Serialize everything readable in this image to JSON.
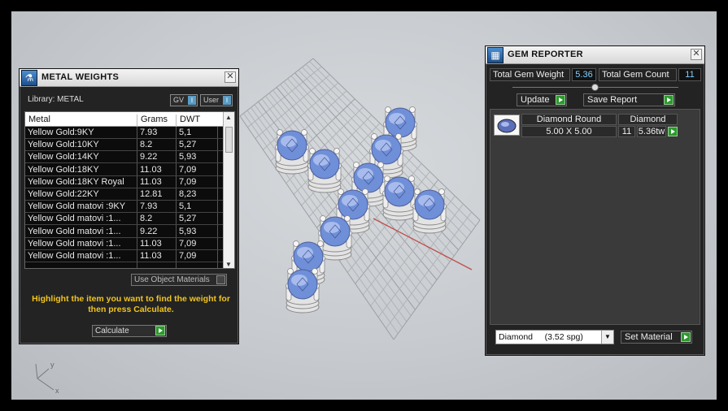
{
  "metal_weights": {
    "title": "METAL WEIGHTS",
    "library_label": "Library: METAL",
    "gv_label": "GV",
    "user_label": "User",
    "toggle_mark": "I",
    "columns": [
      "Metal",
      "Grams",
      "DWT"
    ],
    "rows": [
      {
        "metal": "Yellow Gold:9KY",
        "grams": "7.93",
        "dwt": "5,1"
      },
      {
        "metal": "Yellow Gold:10KY",
        "grams": "8.2",
        "dwt": "5,27"
      },
      {
        "metal": "Yellow Gold:14KY",
        "grams": "9.22",
        "dwt": "5,93"
      },
      {
        "metal": "Yellow Gold:18KY",
        "grams": "11.03",
        "dwt": "7,09"
      },
      {
        "metal": "Yellow Gold:18KY Royal",
        "grams": "11.03",
        "dwt": "7,09"
      },
      {
        "metal": "Yellow Gold:22KY",
        "grams": "12.81",
        "dwt": "8,23"
      },
      {
        "metal": "Yellow Gold matovi :9KY",
        "grams": "7.93",
        "dwt": "5,1"
      },
      {
        "metal": "Yellow Gold matovi :1...",
        "grams": "8.2",
        "dwt": "5,27"
      },
      {
        "metal": "Yellow Gold matovi :1...",
        "grams": "9.22",
        "dwt": "5,93"
      },
      {
        "metal": "Yellow Gold matovi :1...",
        "grams": "11.03",
        "dwt": "7,09"
      },
      {
        "metal": "Yellow Gold matovi :1...",
        "grams": "11.03",
        "dwt": "7,09"
      }
    ],
    "use_object_materials": "Use Object Materials",
    "hint": "Highlight the item you want to find the weight for then press Calculate.",
    "calculate_label": "Calculate"
  },
  "gem_reporter": {
    "title": "GEM REPORTER",
    "total_weight_label": "Total Gem Weight",
    "total_weight_value": "5.36",
    "total_count_label": "Total Gem Count",
    "total_count_value": "11",
    "update_label": "Update",
    "save_report_label": "Save Report",
    "gem": {
      "shape": "Diamond Round",
      "material": "Diamond",
      "size": "5.00 X 5.00",
      "count": "11",
      "weight": "5.36tw"
    },
    "material_dropdown": "Diamond     (3.52 spg)",
    "set_material_label": "Set Material"
  },
  "axis": {
    "x": "x",
    "y": "y"
  },
  "icons": {
    "metal_title_icon": "flask-icon",
    "gem_title_icon": "report-icon",
    "close": "close-icon"
  },
  "colors": {
    "hint_text": "#f0c420",
    "accent_green": "#2c9a2c",
    "gem_blue": "#6f8fd8"
  }
}
